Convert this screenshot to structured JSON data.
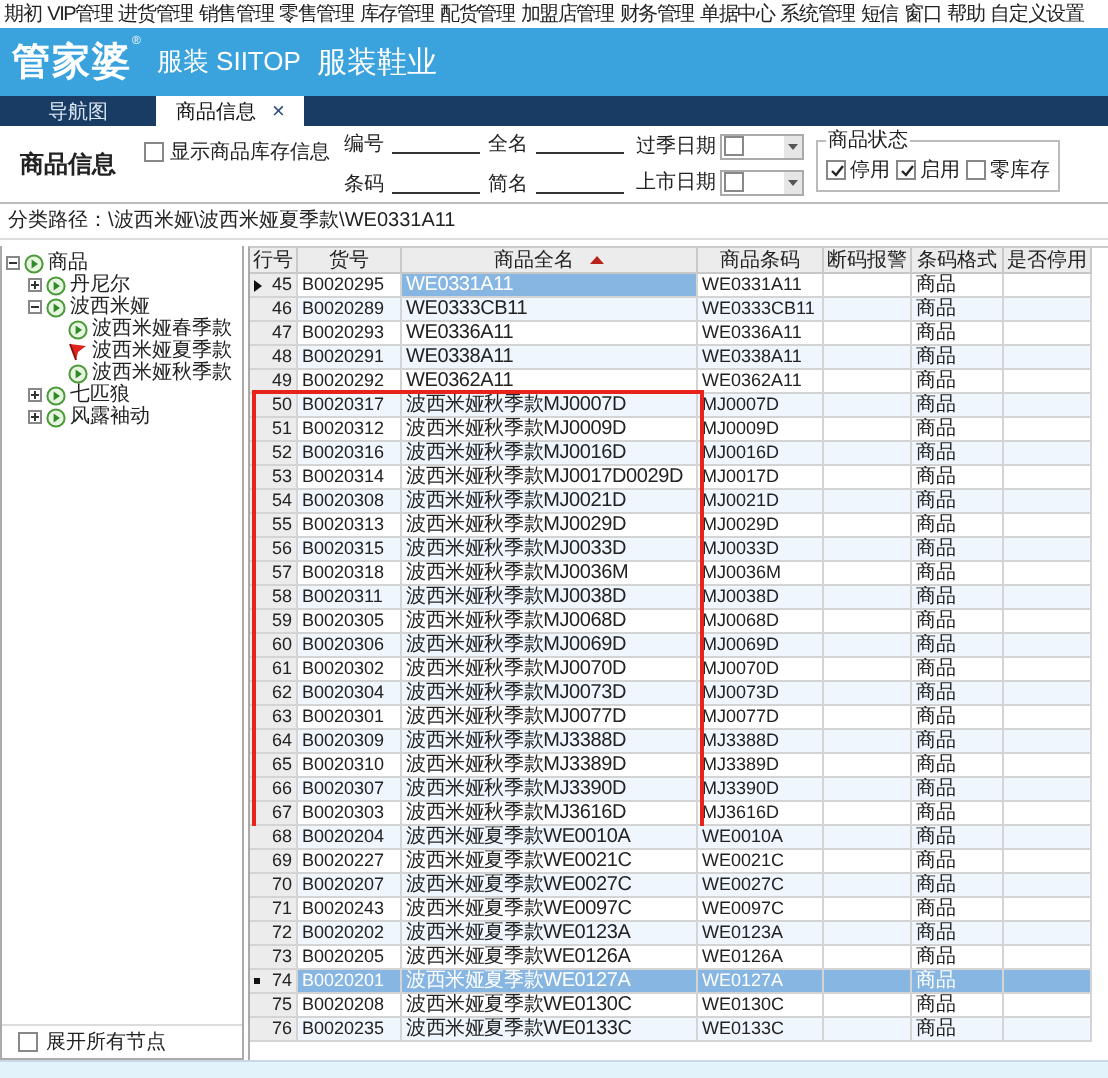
{
  "menu": [
    "期初",
    "VIP管理",
    "进货管理",
    "销售管理",
    "零售管理",
    "库存管理",
    "配货管理",
    "加盟店管理",
    "财务管理",
    "单据中心",
    "系统管理",
    "短信",
    "窗口",
    "帮助",
    "自定义设置"
  ],
  "banner": {
    "logo": "管家婆",
    "registered": "®",
    "product": "服装 SIITOP",
    "edition": "服装鞋业"
  },
  "tabs": [
    {
      "label": "导航图",
      "selected": false,
      "closable": false
    },
    {
      "label": "商品信息",
      "selected": true,
      "closable": true,
      "close": "×"
    }
  ],
  "page_title": "商品信息",
  "filters": {
    "show_stock": {
      "label": "显示商品库存信息",
      "checked": false
    },
    "fields": [
      {
        "label": "编号"
      },
      {
        "label": "全名"
      },
      {
        "label": "条码"
      },
      {
        "label": "简名"
      }
    ],
    "dates": [
      {
        "label": "过季日期",
        "checked": false
      },
      {
        "label": "上市日期",
        "checked": false
      }
    ],
    "status_group": {
      "title": "商品状态",
      "options": [
        {
          "label": "停用",
          "checked": true
        },
        {
          "label": "启用",
          "checked": true
        },
        {
          "label": "零库存",
          "checked": false
        }
      ]
    }
  },
  "breadcrumb": "分类路径：\\波西米娅\\波西米娅夏季款\\WE0331A11",
  "tree": {
    "items": [
      {
        "label": "商品",
        "expanded": true,
        "selected": false,
        "children": [
          {
            "label": "丹尼尔",
            "expanded": false,
            "selected": false
          },
          {
            "label": "波西米娅",
            "expanded": true,
            "selected": false,
            "children": [
              {
                "label": "波西米娅春季款",
                "selected": false
              },
              {
                "label": "波西米娅夏季款",
                "selected": true
              },
              {
                "label": "波西米娅秋季款",
                "selected": false
              }
            ]
          },
          {
            "label": "七匹狼",
            "expanded": false,
            "selected": false
          },
          {
            "label": "风露袖动",
            "expanded": false,
            "selected": false
          }
        ]
      }
    ],
    "expand_all": {
      "label": "展开所有节点",
      "checked": false
    }
  },
  "grid": {
    "columns": [
      {
        "label": "行号",
        "sorted": false
      },
      {
        "label": "货号",
        "sorted": false
      },
      {
        "label": "商品全名",
        "sorted": true
      },
      {
        "label": "商品条码",
        "sorted": false
      },
      {
        "label": "断码报警",
        "sorted": false
      },
      {
        "label": "条码格式",
        "sorted": false
      },
      {
        "label": "是否停用",
        "sorted": false
      }
    ],
    "rows": [
      {
        "no": "45",
        "code": "B0020295",
        "name": "WE0331A11",
        "barcode": "WE0331A11",
        "format": "商品",
        "current": true,
        "selected": false,
        "highlighted": false
      },
      {
        "no": "46",
        "code": "B0020289",
        "name": "WE0333CB11",
        "barcode": "WE0333CB11",
        "format": "商品",
        "current": false,
        "selected": false,
        "highlighted": false
      },
      {
        "no": "47",
        "code": "B0020293",
        "name": "WE0336A11",
        "barcode": "WE0336A11",
        "format": "商品",
        "current": false,
        "selected": false,
        "highlighted": false
      },
      {
        "no": "48",
        "code": "B0020291",
        "name": "WE0338A11",
        "barcode": "WE0338A11",
        "format": "商品",
        "current": false,
        "selected": false,
        "highlighted": false
      },
      {
        "no": "49",
        "code": "B0020292",
        "name": "WE0362A11",
        "barcode": "WE0362A11",
        "format": "商品",
        "current": false,
        "selected": false,
        "highlighted": false
      },
      {
        "no": "50",
        "code": "B0020317",
        "name": "波西米娅秋季款MJ0007D",
        "barcode": "MJ0007D",
        "format": "商品",
        "current": false,
        "selected": false,
        "highlighted": true
      },
      {
        "no": "51",
        "code": "B0020312",
        "name": "波西米娅秋季款MJ0009D",
        "barcode": "MJ0009D",
        "format": "商品",
        "current": false,
        "selected": false,
        "highlighted": true
      },
      {
        "no": "52",
        "code": "B0020316",
        "name": "波西米娅秋季款MJ0016D",
        "barcode": "MJ0016D",
        "format": "商品",
        "current": false,
        "selected": false,
        "highlighted": true
      },
      {
        "no": "53",
        "code": "B0020314",
        "name": "波西米娅秋季款MJ0017D0029D",
        "barcode": "MJ0017D",
        "format": "商品",
        "current": false,
        "selected": false,
        "highlighted": true
      },
      {
        "no": "54",
        "code": "B0020308",
        "name": "波西米娅秋季款MJ0021D",
        "barcode": "MJ0021D",
        "format": "商品",
        "current": false,
        "selected": false,
        "highlighted": true
      },
      {
        "no": "55",
        "code": "B0020313",
        "name": "波西米娅秋季款MJ0029D",
        "barcode": "MJ0029D",
        "format": "商品",
        "current": false,
        "selected": false,
        "highlighted": true
      },
      {
        "no": "56",
        "code": "B0020315",
        "name": "波西米娅秋季款MJ0033D",
        "barcode": "MJ0033D",
        "format": "商品",
        "current": false,
        "selected": false,
        "highlighted": true
      },
      {
        "no": "57",
        "code": "B0020318",
        "name": "波西米娅秋季款MJ0036M",
        "barcode": "MJ0036M",
        "format": "商品",
        "current": false,
        "selected": false,
        "highlighted": true
      },
      {
        "no": "58",
        "code": "B0020311",
        "name": "波西米娅秋季款MJ0038D",
        "barcode": "MJ0038D",
        "format": "商品",
        "current": false,
        "selected": false,
        "highlighted": true
      },
      {
        "no": "59",
        "code": "B0020305",
        "name": "波西米娅秋季款MJ0068D",
        "barcode": "MJ0068D",
        "format": "商品",
        "current": false,
        "selected": false,
        "highlighted": true
      },
      {
        "no": "60",
        "code": "B0020306",
        "name": "波西米娅秋季款MJ0069D",
        "barcode": "MJ0069D",
        "format": "商品",
        "current": false,
        "selected": false,
        "highlighted": true
      },
      {
        "no": "61",
        "code": "B0020302",
        "name": "波西米娅秋季款MJ0070D",
        "barcode": "MJ0070D",
        "format": "商品",
        "current": false,
        "selected": false,
        "highlighted": true
      },
      {
        "no": "62",
        "code": "B0020304",
        "name": "波西米娅秋季款MJ0073D",
        "barcode": "MJ0073D",
        "format": "商品",
        "current": false,
        "selected": false,
        "highlighted": true
      },
      {
        "no": "63",
        "code": "B0020301",
        "name": "波西米娅秋季款MJ0077D",
        "barcode": "MJ0077D",
        "format": "商品",
        "current": false,
        "selected": false,
        "highlighted": true
      },
      {
        "no": "64",
        "code": "B0020309",
        "name": "波西米娅秋季款MJ3388D",
        "barcode": "MJ3388D",
        "format": "商品",
        "current": false,
        "selected": false,
        "highlighted": true
      },
      {
        "no": "65",
        "code": "B0020310",
        "name": "波西米娅秋季款MJ3389D",
        "barcode": "MJ3389D",
        "format": "商品",
        "current": false,
        "selected": false,
        "highlighted": true
      },
      {
        "no": "66",
        "code": "B0020307",
        "name": "波西米娅秋季款MJ3390D",
        "barcode": "MJ3390D",
        "format": "商品",
        "current": false,
        "selected": false,
        "highlighted": true
      },
      {
        "no": "67",
        "code": "B0020303",
        "name": "波西米娅秋季款MJ3616D",
        "barcode": "MJ3616D",
        "format": "商品",
        "current": false,
        "selected": false,
        "highlighted": true
      },
      {
        "no": "68",
        "code": "B0020204",
        "name": "波西米娅夏季款WE0010A",
        "barcode": "WE0010A",
        "format": "商品",
        "current": false,
        "selected": false,
        "highlighted": false
      },
      {
        "no": "69",
        "code": "B0020227",
        "name": "波西米娅夏季款WE0021C",
        "barcode": "WE0021C",
        "format": "商品",
        "current": false,
        "selected": false,
        "highlighted": false
      },
      {
        "no": "70",
        "code": "B0020207",
        "name": "波西米娅夏季款WE0027C",
        "barcode": "WE0027C",
        "format": "商品",
        "current": false,
        "selected": false,
        "highlighted": false
      },
      {
        "no": "71",
        "code": "B0020243",
        "name": "波西米娅夏季款WE0097C",
        "barcode": "WE0097C",
        "format": "商品",
        "current": false,
        "selected": false,
        "highlighted": false
      },
      {
        "no": "72",
        "code": "B0020202",
        "name": "波西米娅夏季款WE0123A",
        "barcode": "WE0123A",
        "format": "商品",
        "current": false,
        "selected": false,
        "highlighted": false
      },
      {
        "no": "73",
        "code": "B0020205",
        "name": "波西米娅夏季款WE0126A",
        "barcode": "WE0126A",
        "format": "商品",
        "current": false,
        "selected": false,
        "highlighted": false
      },
      {
        "no": "74",
        "code": "B0020201",
        "name": "波西米娅夏季款WE0127A",
        "barcode": "WE0127A",
        "format": "商品",
        "current": false,
        "selected": true,
        "highlighted": false
      },
      {
        "no": "75",
        "code": "B0020208",
        "name": "波西米娅夏季款WE0130C",
        "barcode": "WE0130C",
        "format": "商品",
        "current": false,
        "selected": false,
        "highlighted": false
      },
      {
        "no": "76",
        "code": "B0020235",
        "name": "波西米娅夏季款WE0133C",
        "barcode": "WE0133C",
        "format": "商品",
        "current": false,
        "selected": false,
        "highlighted": false
      }
    ]
  }
}
